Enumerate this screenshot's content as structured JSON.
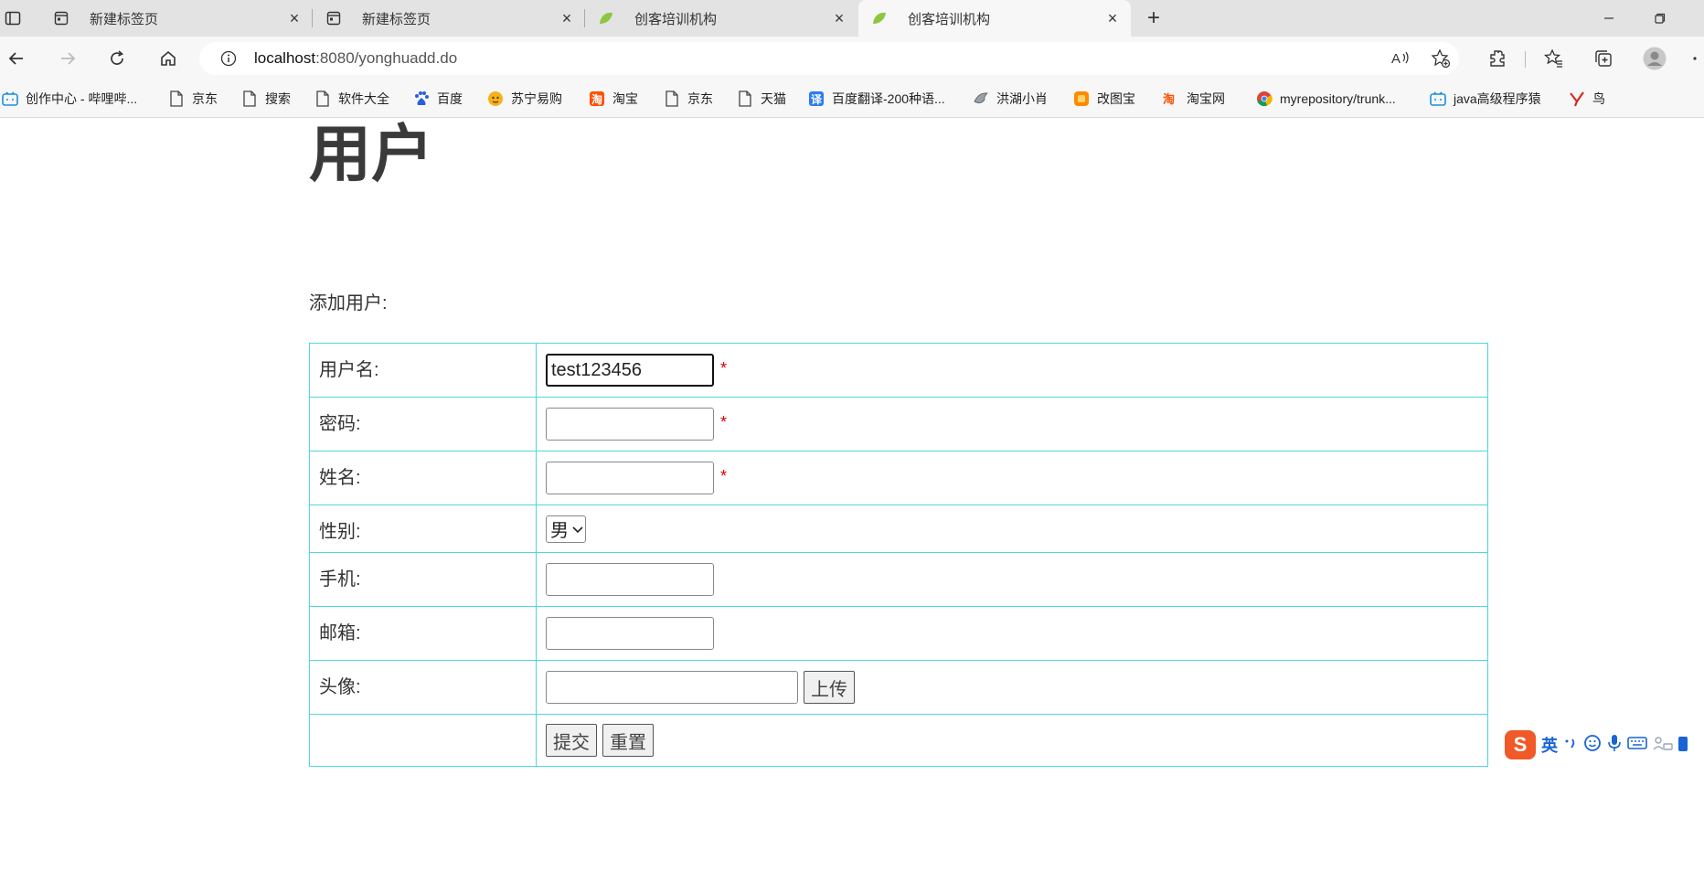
{
  "browser": {
    "tabs": [
      {
        "title": "新建标签页",
        "icon": "page-icon",
        "active": false
      },
      {
        "title": "新建标签页",
        "icon": "page-icon",
        "active": false
      },
      {
        "title": "创客培训机构",
        "icon": "leaf-icon",
        "active": false
      },
      {
        "title": "创客培训机构",
        "icon": "leaf-icon",
        "active": true
      }
    ],
    "address": {
      "host": "localhost",
      "path": ":8080/yonghuadd.do"
    },
    "bookmarks": [
      {
        "label": "创作中心 - 哔哩哔...",
        "icon": "bilibili-icon"
      },
      {
        "label": "京东",
        "icon": "page-icon"
      },
      {
        "label": "搜索",
        "icon": "page-icon"
      },
      {
        "label": "软件大全",
        "icon": "page-icon"
      },
      {
        "label": "百度",
        "icon": "baidu-icon"
      },
      {
        "label": "苏宁易购",
        "icon": "suning-icon"
      },
      {
        "label": "淘宝",
        "icon": "taobao-icon"
      },
      {
        "label": "京东",
        "icon": "page-icon"
      },
      {
        "label": "天猫",
        "icon": "page-icon"
      },
      {
        "label": "百度翻译-200种语...",
        "icon": "translate-icon"
      },
      {
        "label": "洪湖小肖",
        "icon": "bird-icon"
      },
      {
        "label": "改图宝",
        "icon": "gaitubao-icon"
      },
      {
        "label": "淘宝网",
        "icon": "taobao-icon"
      },
      {
        "label": "myrepository/trunk...",
        "icon": "chrome-icon"
      },
      {
        "label": "java高级程序猿",
        "icon": "bilibili-icon"
      },
      {
        "label": "鸟",
        "icon": "bird-icon"
      }
    ]
  },
  "page": {
    "title": "用户",
    "section_label": "添加用户:",
    "form": {
      "username": {
        "label": "用户名:",
        "value": "test123456",
        "required": "*"
      },
      "password": {
        "label": "密码:",
        "value": "",
        "required": "*"
      },
      "name": {
        "label": "姓名:",
        "value": "",
        "required": "*"
      },
      "gender": {
        "label": "性别:",
        "selected": "男"
      },
      "phone": {
        "label": "手机:",
        "value": ""
      },
      "email": {
        "label": "邮箱:",
        "value": ""
      },
      "avatar": {
        "label": "头像:",
        "value": "",
        "upload_label": "上传"
      },
      "submit_label": "提交",
      "reset_label": "重置"
    }
  },
  "ime": {
    "mode": "英"
  },
  "colors": {
    "table_border": "#4fd7dc",
    "required": "#dd0000"
  }
}
